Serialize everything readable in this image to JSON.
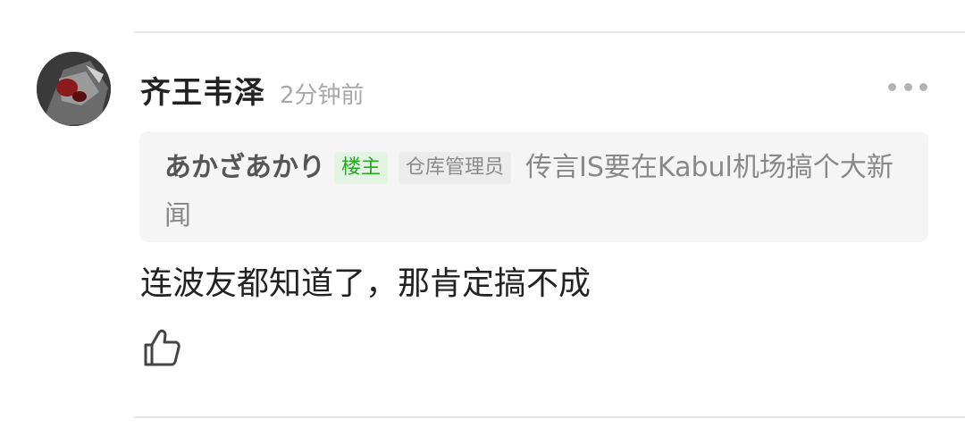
{
  "comment": {
    "author": "齐王韦泽",
    "time": "2分钟前",
    "text": "连波友都知道了，那肯定搞不成"
  },
  "quote": {
    "author": "あかざあかり",
    "badge_owner": "楼主",
    "badge_role": "仓库管理员",
    "text": "传言IS要在Kabul机场搞个大新闻"
  },
  "icons": {
    "more": "more-horizontal-icon",
    "like": "thumbs-up-icon"
  },
  "colors": {
    "owner_badge_bg": "#e3f4e3",
    "owner_badge_text": "#2aa52a",
    "quote_bg": "#f5f5f5"
  }
}
